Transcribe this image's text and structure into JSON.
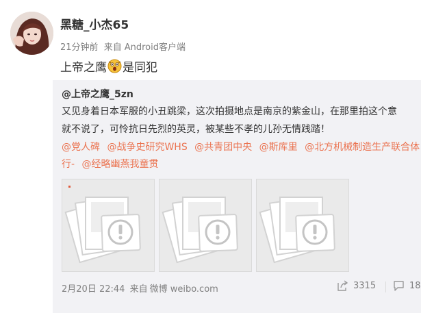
{
  "author": {
    "name": "黑糖_小杰65",
    "time": "21分钟前",
    "source_prefix": "来自",
    "source": "Android客户端"
  },
  "post": {
    "text_before": "上帝之鹰",
    "emoji": "shocked-face-emoji",
    "text_after": "是同犯"
  },
  "repost": {
    "user": "@上帝之鹰_5zn",
    "lines": [
      "又见身着日本军服的小丑跳梁，这次拍摄地点是南京的紫金山，在那里拍这个意",
      "就不说了，可怜抗日先烈的英灵，被某些不孝的儿孙无情践踏！"
    ],
    "mentions_line1": [
      "@党人碑",
      "@战争史研究WHS",
      "@共青团中央",
      "@斯库里",
      "@北方机械制造生产联合体"
    ],
    "mentions_line2": [
      "行-",
      "@经略幽燕我童贯"
    ],
    "images": [
      {
        "icon": "image-load-failed-icon"
      },
      {
        "icon": "image-load-failed-icon"
      },
      {
        "icon": "image-load-failed-icon"
      }
    ],
    "footer": {
      "date": "2月20日 22:44",
      "source_prefix": "来自",
      "source": "微博 weibo.com"
    },
    "share_count": "3315",
    "comment_count": "18"
  },
  "colors": {
    "link": "#eb7350",
    "meta": "#808080",
    "repost_bg": "#f2f2f5"
  }
}
